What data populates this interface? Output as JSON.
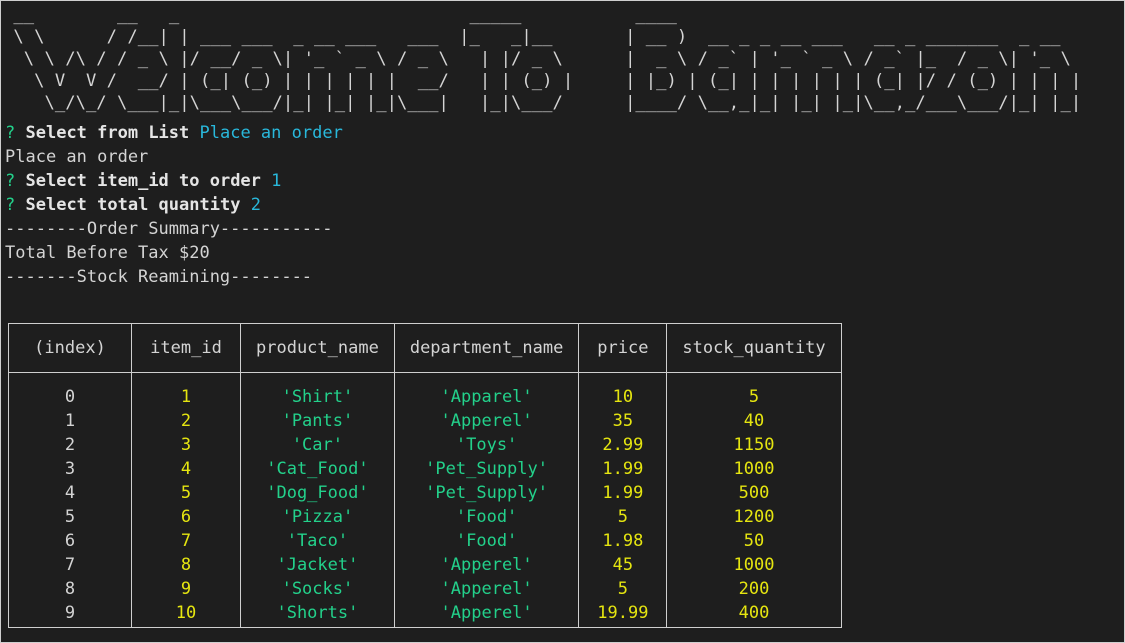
{
  "banner": {
    "text": "Welcome To Bamazon",
    "ascii": " __        __   _                            _____           ____                                        \n \\ \\      / /__| | ___ ___  _ __ ___   ___  |_   _|__       | __ )  __ _ _ __ ___   __ _ _______  _ __  \n  \\ \\ /\\ / / _ \\ |/ __/ _ \\| '_ ` _ \\ / _ \\   | |/ _ \\      |  _ \\ / _` | '_ ` _ \\ / _` |_  / _ \\| '_ \\ \n   \\ V  V /  __/ | (_| (_) | | | | | |  __/   | | (_) |     | |_) | (_| | | | | | | (_| |/ / (_) | | | |\n    \\_/\\_/ \\___|_|\\___\\___/|_| |_| |_|\\___|   |_|\\___/      |____/ \\__,_|_| |_| |_|\\__,_/___\\___/|_| |_|"
  },
  "prompts": [
    {
      "mark": "?",
      "label": "Select from List",
      "answer": "Place an order"
    },
    {
      "echo": "Place an order"
    },
    {
      "mark": "?",
      "label": "Select item_id to order",
      "answer": "1"
    },
    {
      "mark": "?",
      "label": "Select total quantity",
      "answer": "2"
    }
  ],
  "summary": {
    "header": "--------Order Summary-----------",
    "total": "Total Before Tax $20",
    "stock_header": "-------Stock Reamining--------"
  },
  "table": {
    "columns": [
      "(index)",
      "item_id",
      "product_name",
      "department_name",
      "price",
      "stock_quantity"
    ],
    "rows": [
      {
        "index": "0",
        "item_id": "1",
        "product_name": "'Shirt'",
        "department_name": "'Apparel'",
        "price": "10",
        "stock_quantity": "5"
      },
      {
        "index": "1",
        "item_id": "2",
        "product_name": "'Pants'",
        "department_name": "'Apperel'",
        "price": "35",
        "stock_quantity": "40"
      },
      {
        "index": "2",
        "item_id": "3",
        "product_name": "'Car'",
        "department_name": "'Toys'",
        "price": "2.99",
        "stock_quantity": "1150"
      },
      {
        "index": "3",
        "item_id": "4",
        "product_name": "'Cat_Food'",
        "department_name": "'Pet_Supply'",
        "price": "1.99",
        "stock_quantity": "1000"
      },
      {
        "index": "4",
        "item_id": "5",
        "product_name": "'Dog_Food'",
        "department_name": "'Pet_Supply'",
        "price": "1.99",
        "stock_quantity": "500"
      },
      {
        "index": "5",
        "item_id": "6",
        "product_name": "'Pizza'",
        "department_name": "'Food'",
        "price": "5",
        "stock_quantity": "1200"
      },
      {
        "index": "6",
        "item_id": "7",
        "product_name": "'Taco'",
        "department_name": "'Food'",
        "price": "1.98",
        "stock_quantity": "50"
      },
      {
        "index": "7",
        "item_id": "8",
        "product_name": "'Jacket'",
        "department_name": "'Apperel'",
        "price": "45",
        "stock_quantity": "1000"
      },
      {
        "index": "8",
        "item_id": "9",
        "product_name": "'Socks'",
        "department_name": "'Apperel'",
        "price": "5",
        "stock_quantity": "200"
      },
      {
        "index": "9",
        "item_id": "10",
        "product_name": "'Shorts'",
        "department_name": "'Apperel'",
        "price": "19.99",
        "stock_quantity": "400"
      }
    ]
  },
  "colors": {
    "background": "#1e1e1e",
    "text": "#d4d4d4",
    "prompt_mark": "#23d18b",
    "answer": "#29b8db",
    "string_value": "#23d18b",
    "number_value": "#e5e510"
  }
}
